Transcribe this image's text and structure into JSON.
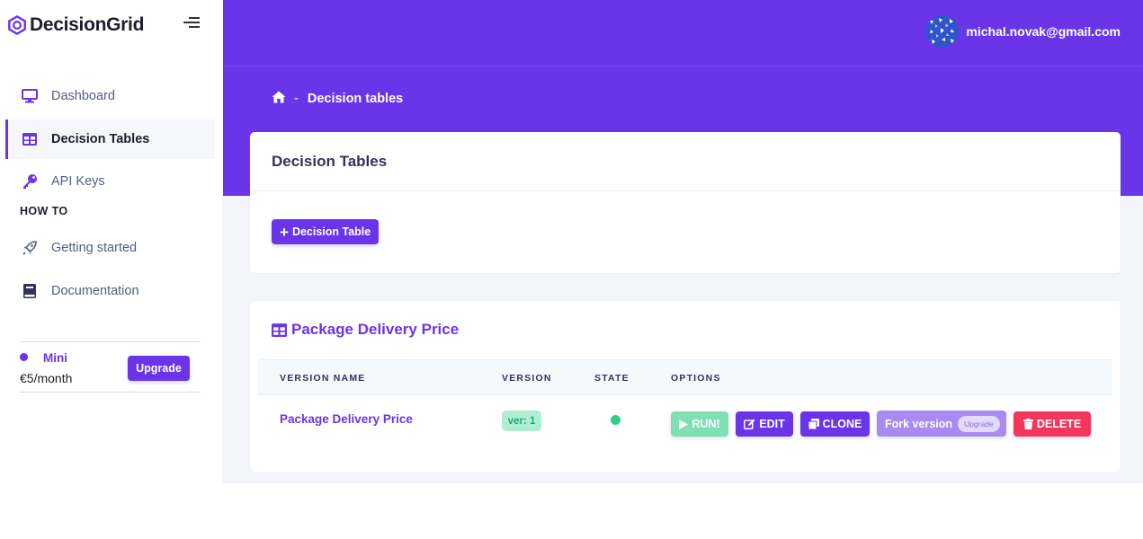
{
  "brand": {
    "name": "DecisionGrid"
  },
  "sidebar": {
    "items": [
      {
        "label": "Dashboard",
        "icon": "monitor-icon"
      },
      {
        "label": "Decision Tables",
        "icon": "table-icon",
        "active": true
      },
      {
        "label": "API Keys",
        "icon": "key-icon"
      }
    ],
    "section_title": "HOW TO",
    "howto_items": [
      {
        "label": "Getting started",
        "icon": "rocket-icon"
      },
      {
        "label": "Documentation",
        "icon": "book-icon"
      }
    ],
    "plan": {
      "name": "Mini",
      "price": "€5/month",
      "upgrade_label": "Upgrade"
    }
  },
  "header": {
    "user_email": "michal.novak@gmail.com"
  },
  "breadcrumb": {
    "separator": "-",
    "current": "Decision tables"
  },
  "tables_card": {
    "title": "Decision Tables",
    "add_button_label": "Decision Table"
  },
  "table_card": {
    "title": "Package Delivery Price",
    "columns": [
      "VERSION NAME",
      "VERSION",
      "STATE",
      "OPTIONS"
    ],
    "row": {
      "version_name": "Package Delivery Price",
      "version": "ver: 1",
      "state": "active"
    },
    "options": {
      "run": "RUN!",
      "edit": "EDIT",
      "clone": "CLONE",
      "fork": "Fork version",
      "fork_badge": "Upgrade",
      "delete": "DELETE"
    }
  },
  "colors": {
    "primary": "#6a35e8",
    "success": "#2dce89",
    "danger": "#f5365c",
    "header_bg": "#6a35e8",
    "page_bg": "#f4f5fa"
  }
}
